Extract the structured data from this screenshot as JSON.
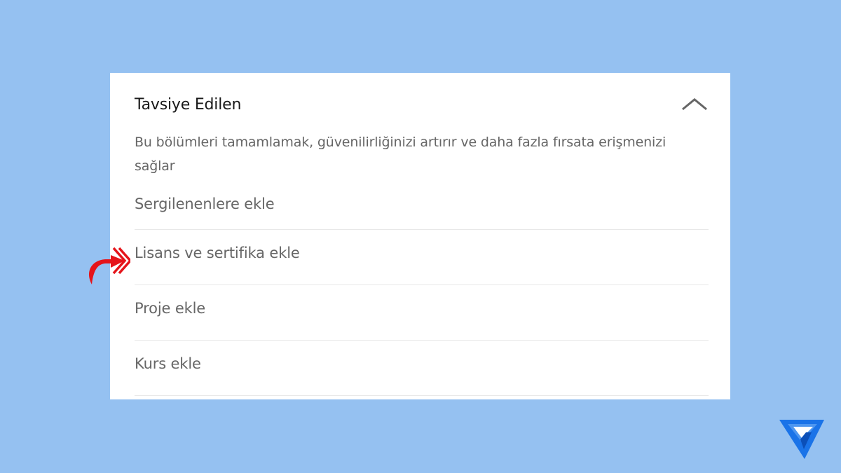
{
  "section": {
    "title": "Tavsiye Edilen",
    "description": "Bu bölümleri tamamlamak, güvenilirliğinizi artırır ve daha fazla fırsata erişmenizi sağlar",
    "toggle_icon": "chevron-up-icon",
    "items": [
      {
        "label": "Sergilenenlere ekle"
      },
      {
        "label": "Lisans ve sertifika ekle"
      },
      {
        "label": "Proje ekle"
      },
      {
        "label": "Kurs ekle"
      }
    ]
  },
  "annotation": {
    "pointer_icon": "curved-arrow-icon",
    "pointer_color": "#e5141a",
    "highlighted_item_index": 1
  },
  "colors": {
    "background": "#95c1f1",
    "card": "#ffffff",
    "title": "#191919",
    "muted_text": "#666666",
    "divider": "#e8e8e8",
    "logo_blue": "#1a73e8"
  },
  "branding": {
    "logo_icon": "triangle-v-logo-icon"
  }
}
